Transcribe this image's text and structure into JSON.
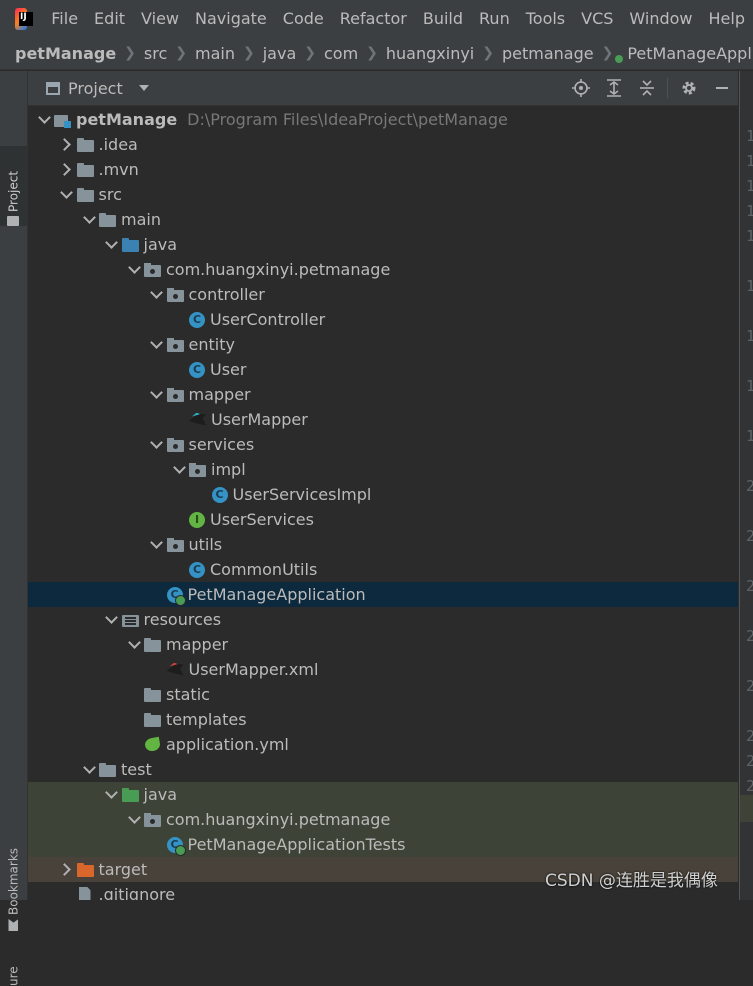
{
  "menu": [
    "File",
    "Edit",
    "View",
    "Navigate",
    "Code",
    "Refactor",
    "Build",
    "Run",
    "Tools",
    "VCS",
    "Window",
    "Help"
  ],
  "breadcrumb": [
    "petManage",
    "src",
    "main",
    "java",
    "com",
    "huangxinyi",
    "petmanage",
    "PetManageApplication"
  ],
  "left_stripe": {
    "project": "Project",
    "bookmarks": "Bookmarks",
    "structure": "ure"
  },
  "project_panel": {
    "title": "Project"
  },
  "tree": [
    {
      "label": "petManage",
      "path": "D:\\Program Files\\IdeaProject\\petManage",
      "icon": "module-icon",
      "depth": 0,
      "state": "expanded"
    },
    {
      "label": ".idea",
      "icon": "folder-icon",
      "depth": 1,
      "state": "collapsed"
    },
    {
      "label": ".mvn",
      "icon": "folder-icon",
      "depth": 1,
      "state": "collapsed"
    },
    {
      "label": "src",
      "icon": "folder-icon",
      "depth": 1,
      "state": "expanded"
    },
    {
      "label": "main",
      "icon": "folder-icon",
      "depth": 2,
      "state": "expanded"
    },
    {
      "label": "java",
      "icon": "source-folder-icon",
      "depth": 3,
      "state": "expanded"
    },
    {
      "label": "com.huangxinyi.petmanage",
      "icon": "package-icon",
      "depth": 4,
      "state": "expanded"
    },
    {
      "label": "controller",
      "icon": "package-icon",
      "depth": 5,
      "state": "expanded"
    },
    {
      "label": "UserController",
      "icon": "class-icon",
      "depth": 6,
      "state": "leaf"
    },
    {
      "label": "entity",
      "icon": "package-icon",
      "depth": 5,
      "state": "expanded"
    },
    {
      "label": "User",
      "icon": "class-icon",
      "depth": 6,
      "state": "leaf"
    },
    {
      "label": "mapper",
      "icon": "package-icon",
      "depth": 5,
      "state": "expanded"
    },
    {
      "label": "UserMapper",
      "icon": "mybatis-mapper-icon",
      "depth": 6,
      "state": "leaf"
    },
    {
      "label": "services",
      "icon": "package-icon",
      "depth": 5,
      "state": "expanded"
    },
    {
      "label": "impl",
      "icon": "package-icon",
      "depth": 6,
      "state": "expanded"
    },
    {
      "label": "UserServicesImpl",
      "icon": "class-icon",
      "depth": 7,
      "state": "leaf"
    },
    {
      "label": "UserServices",
      "icon": "interface-icon",
      "depth": 6,
      "state": "leaf"
    },
    {
      "label": "utils",
      "icon": "package-icon",
      "depth": 5,
      "state": "expanded"
    },
    {
      "label": "CommonUtils",
      "icon": "class-icon",
      "depth": 6,
      "state": "leaf"
    },
    {
      "label": "PetManageApplication",
      "icon": "spring-boot-class-icon",
      "depth": 5,
      "state": "leaf",
      "selected": true
    },
    {
      "label": "resources",
      "icon": "resources-folder-icon",
      "depth": 3,
      "state": "expanded"
    },
    {
      "label": "mapper",
      "icon": "folder-icon",
      "depth": 4,
      "state": "expanded"
    },
    {
      "label": "UserMapper.xml",
      "icon": "mybatis-xml-icon",
      "depth": 5,
      "state": "leaf"
    },
    {
      "label": "static",
      "icon": "folder-icon",
      "depth": 4,
      "state": "leaf"
    },
    {
      "label": "templates",
      "icon": "folder-icon",
      "depth": 4,
      "state": "leaf"
    },
    {
      "label": "application.yml",
      "icon": "spring-config-icon",
      "depth": 4,
      "state": "leaf"
    },
    {
      "label": "test",
      "icon": "folder-icon",
      "depth": 2,
      "state": "expanded"
    },
    {
      "label": "java",
      "icon": "test-folder-icon",
      "depth": 3,
      "state": "expanded",
      "highlight": "test"
    },
    {
      "label": "com.huangxinyi.petmanage",
      "icon": "package-icon",
      "depth": 4,
      "state": "expanded",
      "highlight": "test"
    },
    {
      "label": "PetManageApplicationTests",
      "icon": "spring-boot-class-icon",
      "depth": 5,
      "state": "leaf",
      "highlight": "test"
    },
    {
      "label": "target",
      "icon": "excluded-folder-icon",
      "depth": 1,
      "state": "collapsed",
      "highlight": "excluded"
    },
    {
      "label": ".gitignore",
      "icon": "file-icon",
      "depth": 1,
      "state": "leaf"
    }
  ],
  "gutter_lines": [
    "1",
    "1",
    "1",
    "1",
    "1",
    "1",
    "1",
    "1",
    "1",
    "2",
    "2",
    "2",
    "2",
    "2",
    "2",
    "2",
    "2"
  ],
  "watermark": "CSDN @连胜是我偶像",
  "colors": {
    "selection": "#0d293e",
    "test_bg": "#3e4337",
    "excluded_bg": "#49423a",
    "class_icon": "#3592c4",
    "interface_icon": "#62b543",
    "source_folder": "#3b81b2",
    "test_folder": "#499c54",
    "excluded_folder": "#d9672c"
  }
}
